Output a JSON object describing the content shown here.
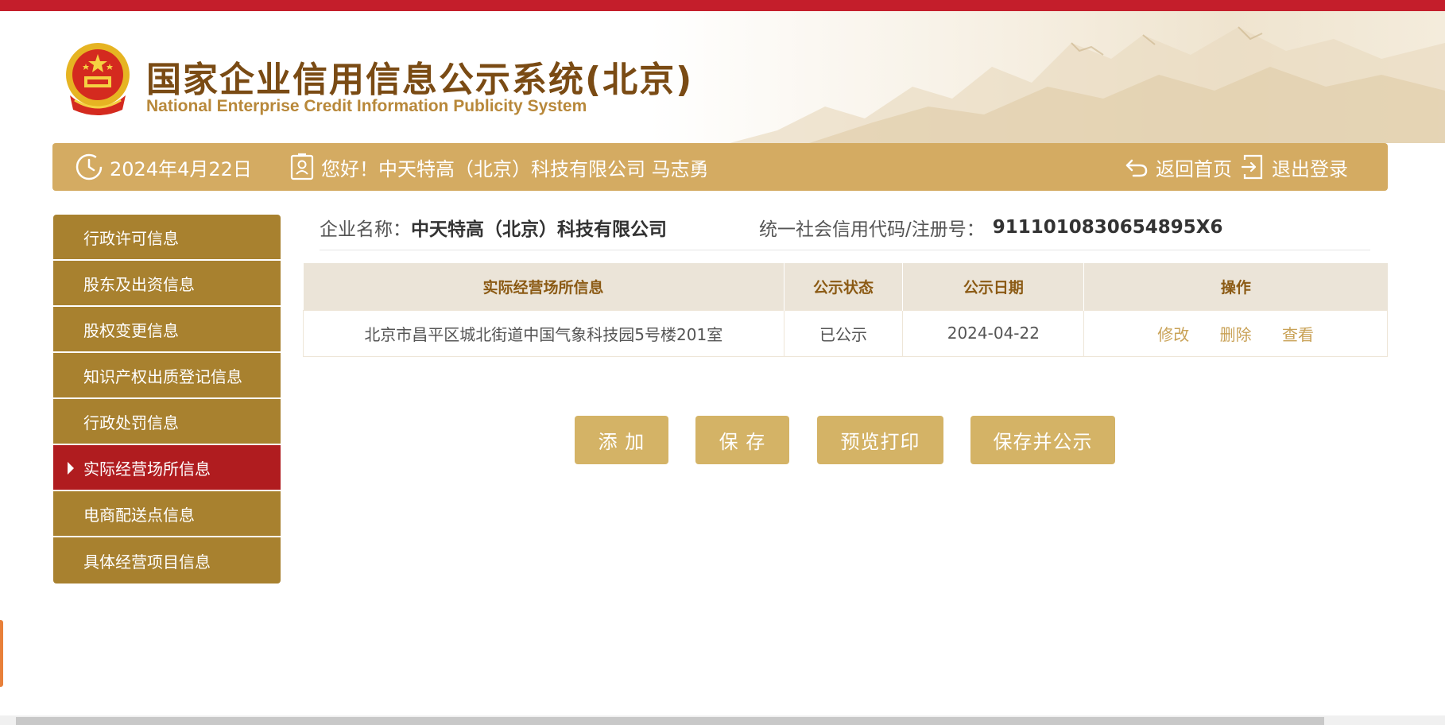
{
  "header": {
    "title_cn": "国家企业信用信息公示系统(北京)",
    "title_en": "National Enterprise Credit Information Publicity System"
  },
  "infobar": {
    "date": "2024年4月22日",
    "greeting": "您好！中天特高（北京）科技有限公司  马志勇",
    "home_label": "返回首页",
    "logout_label": "退出登录"
  },
  "sidebar": {
    "items": [
      {
        "label": "行政许可信息",
        "active": false
      },
      {
        "label": "股东及出资信息",
        "active": false
      },
      {
        "label": "股权变更信息",
        "active": false
      },
      {
        "label": "知识产权出质登记信息",
        "active": false
      },
      {
        "label": "行政处罚信息",
        "active": false
      },
      {
        "label": "实际经营场所信息",
        "active": true
      },
      {
        "label": "电商配送点信息",
        "active": false
      },
      {
        "label": "具体经营项目信息",
        "active": false
      }
    ]
  },
  "company": {
    "name_label": "企业名称：",
    "name_value": "中天特高（北京）科技有限公司",
    "code_label": "统一社会信用代码/注册号：",
    "code_value": "9111010830654895X6"
  },
  "table": {
    "headers": [
      "实际经营场所信息",
      "公示状态",
      "公示日期",
      "操作"
    ],
    "rows": [
      {
        "address": "北京市昌平区城北街道中国气象科技园5号楼201室",
        "status": "已公示",
        "date": "2024-04-22",
        "ops": [
          "修改",
          "删除",
          "查看"
        ]
      }
    ]
  },
  "buttons": {
    "add": "添 加",
    "save": "保 存",
    "preview": "预览打印",
    "publish": "保存并公示"
  },
  "colors": {
    "top_stripe": "#c41e2b",
    "infobar": "#d4ab62",
    "menu": "#a8812f",
    "menu_active": "#b01c1f",
    "button": "#d4b366",
    "link": "#c9a257"
  }
}
